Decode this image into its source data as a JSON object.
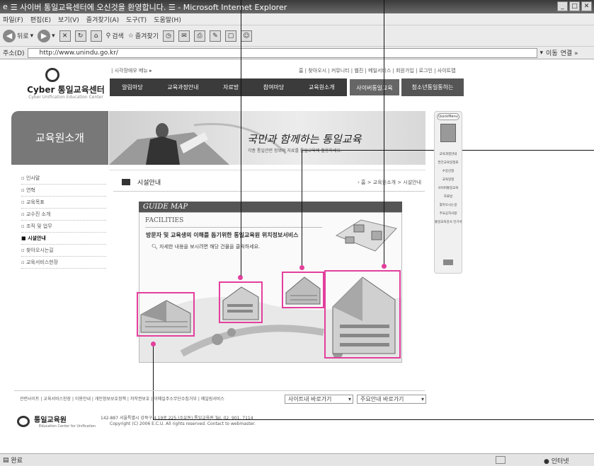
{
  "window": {
    "title": "☰ 사이버 통일교육센터에 오신것을 환영합니다. ☰ - Microsoft Internet Explorer"
  },
  "menu": [
    "파일(F)",
    "편집(E)",
    "보기(V)",
    "즐겨찾기(A)",
    "도구(T)",
    "도움말(H)"
  ],
  "toolbar": {
    "back": "뒤로",
    "search": "검색",
    "favorites": "즐겨찾기"
  },
  "address": {
    "label": "주소(D)",
    "url": "http://www.unindu.go.kr/",
    "go": "이동",
    "links": "연결 »"
  },
  "site": {
    "logo": "Cyber 통일교육센터",
    "logo_sub": "Cyber Unification Education Center",
    "skip": "| 시각장애우 메뉴 ▸",
    "util": "홈 | 찾아오시 | 커뮤니티 | 웹진 | 메일서비스 | 회원가입 | 로그인 | 사이트맵",
    "gnb": [
      "알림마당",
      "교육과정안내",
      "자료방",
      "참여마당",
      "교육원소개"
    ],
    "gnb_cyber": "사이버통일교육",
    "gnb_youth": "청소년통일통하는"
  },
  "left": {
    "title": "교육원소개",
    "items": [
      "인사말",
      "연혁",
      "교육목표",
      "교수진 소개",
      "조직 및 업무",
      "시설안내",
      "찾아오시는길",
      "교육서비스헌장"
    ]
  },
  "banner": {
    "title": "국민과 함께하는 통일교육",
    "sub": "각종 통일관련 정보와 자료를 통일교육에 활용하세요."
  },
  "content": {
    "title": "시설안내",
    "breadcrumb": "› 홈 > 교육원소개 > 시설안내",
    "guide_title": "GUIDE MAP",
    "facilities": "FACILITIES",
    "desc": "방문자 및 교육생의 이해를 돕기위한 통일교육원 위치정보서비스",
    "hint": "자세한 내용을 보시려면 해당 건물을 클릭하세요."
  },
  "quickmenu": {
    "head": "QuickMenu",
    "items": [
      "교육과정안내",
      "연간교육일정표",
      "수강신청",
      "교육일정",
      "사이버통일교육",
      "자료방",
      "찾아오시는길",
      "주요공지사항",
      "통일교육강사 인기서 출력"
    ]
  },
  "footer": {
    "links": "관련사이트 | 교육서비스헌장 | 이용안내 | 개인정보보호정책 | 저작권보호 | 이메일주소무단수집거부 | 메일링서비스",
    "select1": "사이트내 바로가기",
    "select2": "주요안내 바로가기",
    "logo": "통일교육원",
    "logo_sub": "Education Center for Unification",
    "address": "142-887 서울특별시 강북구 4.19로 225 (수유동) 통일교육원 Tel. 02. 901. 7114",
    "copyright": "Copyright (C) 2006 E.C.U. All rights reserved. Contact to webmaster."
  },
  "status": {
    "left": "완료",
    "zone": "인터넷"
  },
  "colors": {
    "highlight": "#e33f9c",
    "nav_dark": "#3b3b3b"
  }
}
